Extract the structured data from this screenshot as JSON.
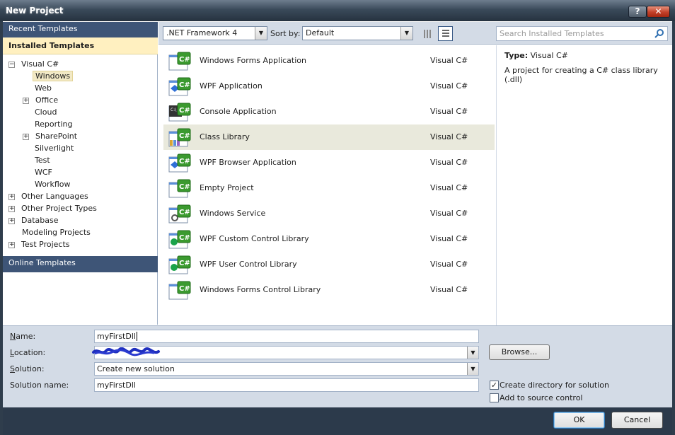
{
  "window": {
    "title": "New Project",
    "help_label": "?",
    "close_label": "✕"
  },
  "nav": {
    "recent": "Recent Templates",
    "installed": "Installed Templates",
    "online": "Online Templates",
    "tree": [
      {
        "label": "Visual C#",
        "expander": "−"
      },
      {
        "label": "Windows",
        "selected": true
      },
      {
        "label": "Web"
      },
      {
        "label": "Office",
        "expander": "+"
      },
      {
        "label": "Cloud"
      },
      {
        "label": "Reporting"
      },
      {
        "label": "SharePoint",
        "expander": "+"
      },
      {
        "label": "Silverlight"
      },
      {
        "label": "Test"
      },
      {
        "label": "WCF"
      },
      {
        "label": "Workflow"
      },
      {
        "label": "Other Languages",
        "expander": "+"
      },
      {
        "label": "Other Project Types",
        "expander": "+"
      },
      {
        "label": "Database",
        "expander": "+"
      },
      {
        "label": "Modeling Projects"
      },
      {
        "label": "Test Projects",
        "expander": "+"
      }
    ]
  },
  "toolbar": {
    "framework": ".NET Framework 4",
    "sort_by_label": "Sort by:",
    "sort_by_value": "Default",
    "search_placeholder": "Search Installed Templates"
  },
  "templates": [
    {
      "name": "Windows Forms Application",
      "lang": "Visual C#",
      "icon": "winforms-app-icon"
    },
    {
      "name": "WPF Application",
      "lang": "Visual C#",
      "icon": "wpf-app-icon"
    },
    {
      "name": "Console Application",
      "lang": "Visual C#",
      "icon": "console-app-icon"
    },
    {
      "name": "Class Library",
      "lang": "Visual C#",
      "icon": "class-library-icon",
      "selected": true
    },
    {
      "name": "WPF Browser Application",
      "lang": "Visual C#",
      "icon": "wpf-browser-app-icon"
    },
    {
      "name": "Empty Project",
      "lang": "Visual C#",
      "icon": "empty-project-icon"
    },
    {
      "name": "Windows Service",
      "lang": "Visual C#",
      "icon": "windows-service-icon"
    },
    {
      "name": "WPF Custom Control Library",
      "lang": "Visual C#",
      "icon": "wpf-custom-control-icon"
    },
    {
      "name": "WPF User Control Library",
      "lang": "Visual C#",
      "icon": "wpf-user-control-icon"
    },
    {
      "name": "Windows Forms Control Library",
      "lang": "Visual C#",
      "icon": "winforms-control-icon"
    }
  ],
  "detail": {
    "type_label": "Type:",
    "type_value": "Visual C#",
    "description": "A project for creating a C# class library (.dll)"
  },
  "form": {
    "name_label_key": "N",
    "name_label_rest": "ame:",
    "name_value": "myFirstDll",
    "location_label_key": "L",
    "location_label_rest": "ocation:",
    "solution_label_key": "S",
    "solution_label_rest": "olution:",
    "solution_value": "Create new solution",
    "solution_name_label": "Solution name:",
    "solution_name_value": "myFirstDll",
    "browse_label": "Browse...",
    "create_dir_label": "Create directory for solution",
    "create_dir_checked": true,
    "source_control_label": "Add to source control",
    "source_control_checked": false
  },
  "buttons": {
    "ok": "OK",
    "cancel": "Cancel"
  },
  "colors": {
    "nav_header": "#3e5577",
    "installed_highlight": "#fff0c0",
    "chrome": "#d3dbe6",
    "footer": "#2c3a4b"
  }
}
